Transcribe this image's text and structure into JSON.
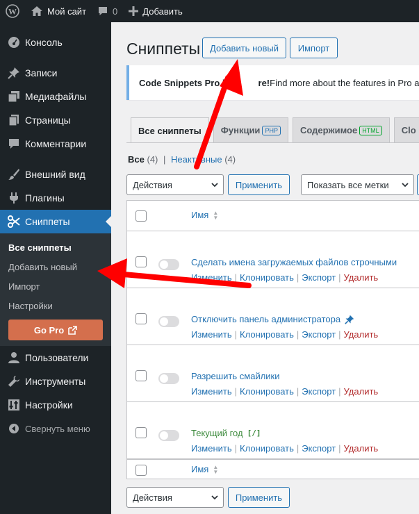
{
  "adminbar": {
    "site_name": "Мой сайт",
    "comments_count": "0",
    "add_new": "Добавить"
  },
  "sidebar": {
    "items": [
      {
        "label": "Консоль",
        "icon": "gauge-icon"
      },
      {
        "label": "Записи",
        "icon": "pin-icon"
      },
      {
        "label": "Медиафайлы",
        "icon": "media-icon"
      },
      {
        "label": "Страницы",
        "icon": "pages-icon"
      },
      {
        "label": "Комментарии",
        "icon": "comment-icon"
      },
      {
        "label": "Внешний вид",
        "icon": "brush-icon"
      },
      {
        "label": "Плагины",
        "icon": "plug-icon"
      },
      {
        "label": "Сниппеты",
        "icon": "scissors-icon"
      },
      {
        "label": "Пользователи",
        "icon": "user-icon"
      },
      {
        "label": "Инструменты",
        "icon": "wrench-icon"
      },
      {
        "label": "Настройки",
        "icon": "settings-icon"
      }
    ],
    "submenu": [
      "Все сниппеты",
      "Добавить новый",
      "Импорт",
      "Настройки"
    ],
    "go_pro": "Go Pro",
    "collapse": "Свернуть меню"
  },
  "main": {
    "title": "Сниппеты",
    "add_new_button": "Добавить новый",
    "import_button": "Импорт",
    "notice_bold": "Code Snippets Pro i",
    "notice_bold_tail": "re!",
    "notice_text": " Find more about the features in Pro and ou",
    "tabs": [
      {
        "label": "Все сниппеты"
      },
      {
        "label": "Функции",
        "badge": "PHP"
      },
      {
        "label": "Содержимое",
        "badge": "HTML"
      },
      {
        "label": "Clo"
      }
    ],
    "filter": {
      "all_label": "Все",
      "all_count": "(4)",
      "separator": "|",
      "inactive_label": "Неактивные",
      "inactive_count": "(4)"
    },
    "bulk_action": "Действия",
    "apply_button": "Применить",
    "tags_filter": "Показать все метки",
    "column_name": "Имя",
    "row_actions": {
      "edit": "Изменить",
      "clone": "Клонировать",
      "export": "Экспорт",
      "delete": "Удалить"
    },
    "snippets": [
      {
        "title": "Сделать имена загружаемых файлов строчными"
      },
      {
        "title": "Отключить панель администратора"
      },
      {
        "title": "Разрешить смайлики"
      },
      {
        "title": "Текущий год",
        "shortcode": "[/]"
      }
    ]
  },
  "colors": {
    "admin_dark": "#1d2327",
    "accent": "#2271b1",
    "go_pro": "#d46f4d",
    "arrow": "#ff0000",
    "delete": "#b32d2e"
  }
}
